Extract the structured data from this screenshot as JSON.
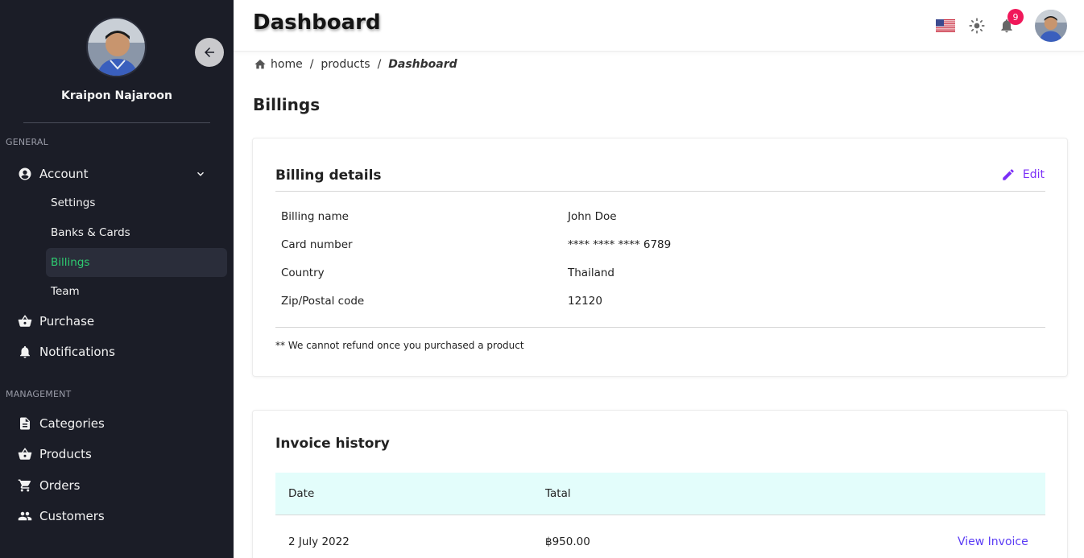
{
  "sidebar": {
    "user_name": "Kraipon Najaroon",
    "general_label": "GENERAL",
    "management_label": "MANAGEMENT",
    "account": {
      "label": "Account",
      "icon": "account-circle-icon"
    },
    "account_sub": [
      "Settings",
      "Banks & Cards",
      "Billings",
      "Team"
    ],
    "active_sub": "Billings",
    "purchase": "Purchase",
    "notifications": "Notifications",
    "categories": "Categories",
    "products": "Products",
    "orders": "Orders",
    "customers": "Customers",
    "active_color": "#2ecc71",
    "background": "#1b1d27"
  },
  "header": {
    "title": "Dashboard",
    "notification_count": "9",
    "badge_color": "#f0185a"
  },
  "breadcrumb": {
    "home": "home",
    "products": "products",
    "current": "Dashboard",
    "sep": "/"
  },
  "page": {
    "section_title": "Billings"
  },
  "billing": {
    "title": "Billing details",
    "edit_label": "Edit",
    "accent_color": "#7b2ff7",
    "rows": [
      {
        "label": "Billing name",
        "value": "John Doe"
      },
      {
        "label": "Card number",
        "value": "**** **** **** 6789"
      },
      {
        "label": "Country",
        "value": "Thailand"
      },
      {
        "label": "Zip/Postal code",
        "value": "12120"
      }
    ],
    "note": "** We cannot refund once you purchased a product"
  },
  "invoices": {
    "title": "Invoice history",
    "columns": [
      "Date",
      "Tatal"
    ],
    "rows": [
      {
        "date": "2 July 2022",
        "total": "฿950.00",
        "action": "View Invoice"
      }
    ],
    "header_bg": "#e3fdfb"
  }
}
